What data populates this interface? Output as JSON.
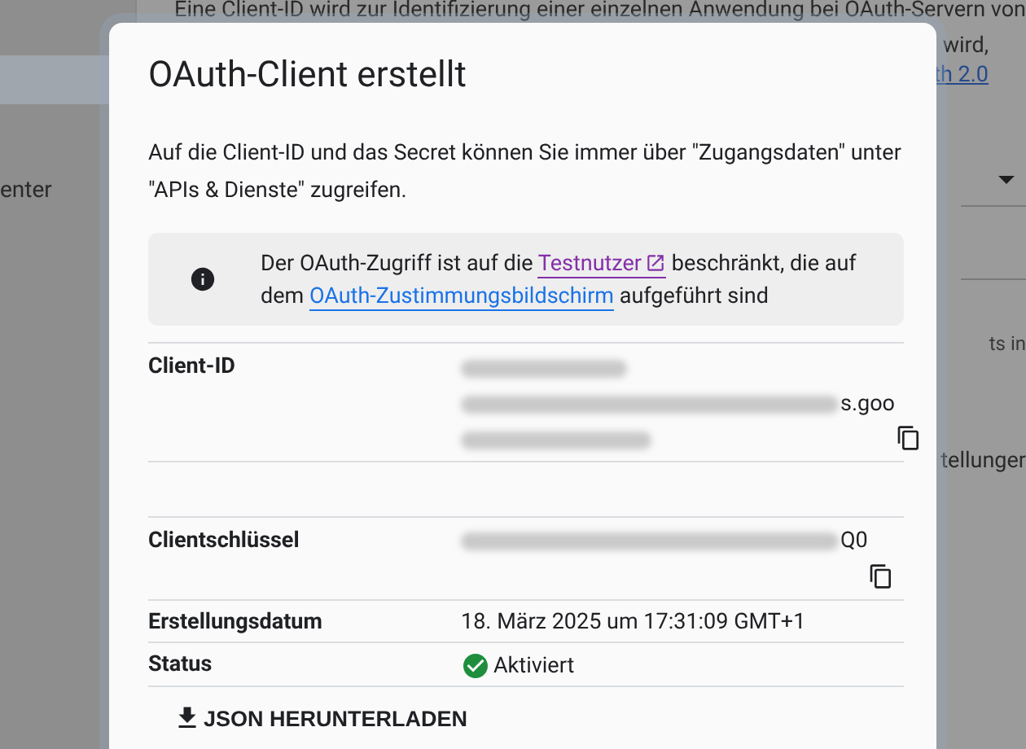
{
  "background": {
    "intro_line": "Eine Client-ID wird zur Identifizierung einer einzelnen Anwendung bei OAuth-Servern von",
    "intro_tail": "wird,",
    "link_tail": "th 2.0",
    "sidebar_label": "enter",
    "hint_tail": "ts in",
    "setting_tail": "tellunger"
  },
  "dialog": {
    "title": "OAuth-Client erstellt",
    "description": "Auf die Client-ID und das Secret können Sie immer über \"Zugangsdaten\" unter \"APIs & Dienste\" zugreifen.",
    "notice": [
      {
        "kind": "text",
        "text": "Der OAuth-Zugriff ist auf die "
      },
      {
        "kind": "external_link",
        "text": "Testnutzer"
      },
      {
        "kind": "text",
        "text": " beschränkt, die auf dem "
      },
      {
        "kind": "link",
        "text": "OAuth-Zustimmungsbildschirm"
      },
      {
        "kind": "text",
        "text": " aufgeführt sind"
      }
    ],
    "fields": [
      {
        "kind": "long_secret",
        "label": "Client-ID",
        "visible_tail": "s.goo",
        "copyable": true
      },
      {
        "kind": "empty"
      },
      {
        "kind": "secret",
        "label": "Clientschlüssel",
        "visible_tail": "Q0",
        "copyable": true
      },
      {
        "kind": "text",
        "label": "Erstellungsdatum",
        "value": "18. März 2025 um 17:31:09 GMT+1"
      },
      {
        "kind": "status",
        "label": "Status",
        "value": "Aktiviert",
        "active": true
      }
    ],
    "download_button": "JSON HERUNTERLADEN"
  }
}
